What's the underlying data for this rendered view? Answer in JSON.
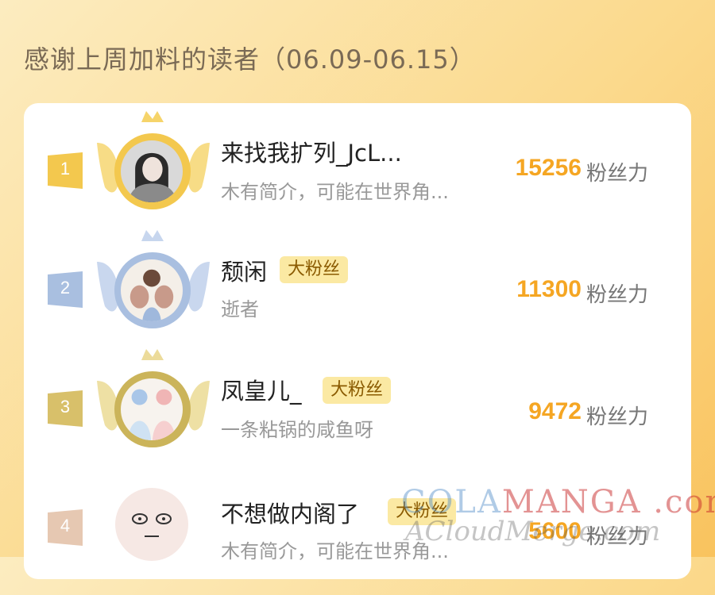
{
  "header": {
    "title": "感谢上周加料的读者（06.09-06.15）"
  },
  "colors": {
    "gold": "#f3c84e",
    "silver": "#a9bfe0",
    "bronze": "#d8c06a",
    "fourth": "#e6c8b2",
    "score": "#f5a623",
    "badge_bg": "#fbe9a3"
  },
  "readers": [
    {
      "rank": "1",
      "name": "来找我扩列_JcL...",
      "bio": "木有简介，可能在世界角...",
      "score": "15256",
      "unit": "粉丝力",
      "badge": ""
    },
    {
      "rank": "2",
      "name": "颓闲",
      "bio": "逝者",
      "score": "11300",
      "unit": "粉丝力",
      "badge": "大粉丝"
    },
    {
      "rank": "3",
      "name": "凤皇儿_",
      "bio": "一条粘锅的咸鱼呀",
      "score": "9472",
      "unit": "粉丝力",
      "badge": "大粉丝"
    },
    {
      "rank": "4",
      "name": "不想做内阁了",
      "bio": "木有简介，可能在世界角...",
      "score": "5600",
      "unit": "粉丝力",
      "badge": "大粉丝"
    }
  ],
  "watermark": {
    "line1_blue": "COLA",
    "line1_red": "MANGA",
    "line1_tail": ".com",
    "line2": "ACloudMerge.com"
  }
}
